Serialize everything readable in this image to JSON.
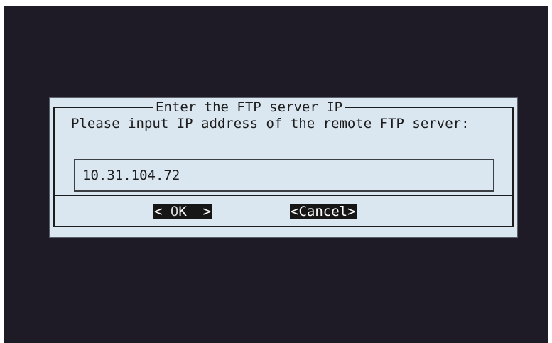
{
  "dialog": {
    "title": "Enter the FTP server IP",
    "message": "Please input IP address of the remote FTP server:",
    "input_value": "10.31.104.72"
  },
  "buttons": {
    "ok_left": "< ",
    "ok_hotkey": "O",
    "ok_rest": "K  >",
    "cancel_label": "<Cancel>"
  },
  "colors": {
    "terminal_background": "#1e1b26",
    "dialog_background": "#dae6f0",
    "button_background": "#161616",
    "button_text": "#ffffff"
  }
}
